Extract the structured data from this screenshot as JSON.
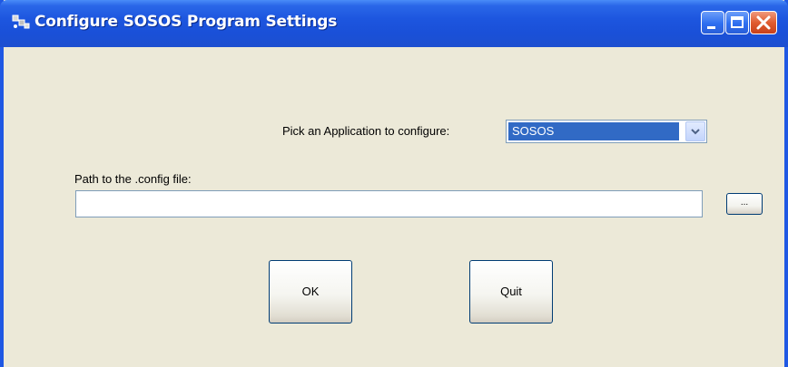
{
  "window": {
    "title": "Configure SOSOS Program Settings",
    "icon": "app-icon",
    "controls": [
      "minimize-icon",
      "maximize-icon",
      "close-icon"
    ]
  },
  "form": {
    "app_picker": {
      "label": "Pick an Application to configure:",
      "selected": "SOSOS"
    },
    "config_path": {
      "label": "Path to the .config file:",
      "value": "",
      "browse_label": "..."
    },
    "buttons": {
      "ok_label": "OK",
      "quit_label": "Quit"
    }
  },
  "colors": {
    "titlebar": "#1d56df",
    "window_background": "#ece9d8",
    "selection": "#316ac5",
    "close_button": "#e05c30"
  }
}
